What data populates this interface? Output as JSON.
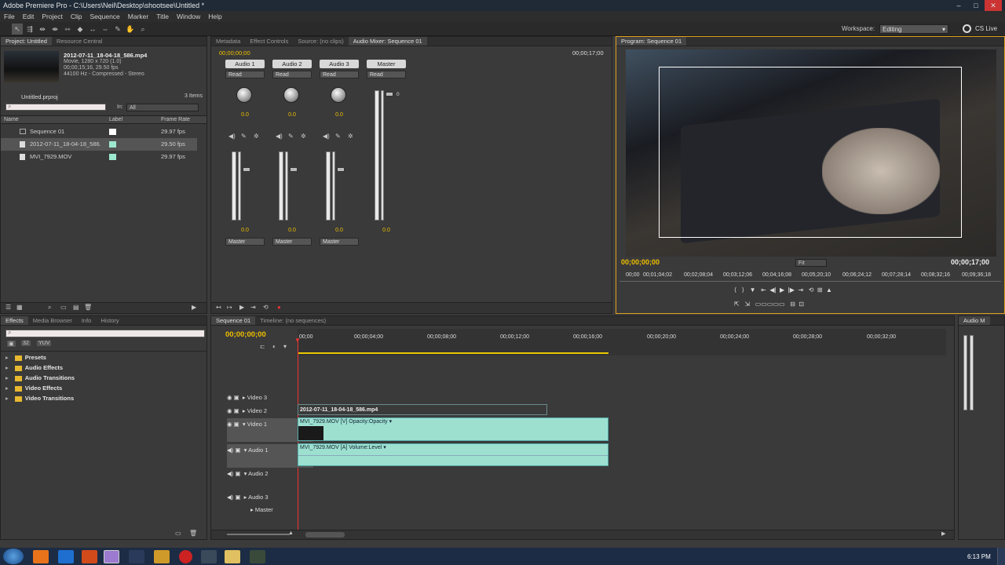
{
  "window": {
    "title": "Adobe Premiere Pro - C:\\Users\\Neil\\Desktop\\shootsee\\Untitled *"
  },
  "menu": [
    "File",
    "Edit",
    "Project",
    "Clip",
    "Sequence",
    "Marker",
    "Title",
    "Window",
    "Help"
  ],
  "workspace": {
    "label": "Workspace:",
    "value": "Editing",
    "cslive": "CS Live"
  },
  "project": {
    "tabs": [
      "Project: Untitled",
      "Resource Central"
    ],
    "clip_name": "2012-07-11_18-04-18_586.mp4",
    "clip_info": [
      "Movie, 1280 x 720 (1.0)",
      "00;00;15;16, 29.50 fps",
      "44100 Hz - Compressed - Stereo"
    ],
    "file": "Untitled.prproj",
    "items_count": "3 Items",
    "in_label": "In:",
    "in_value": "All",
    "columns": [
      "Name",
      "Label",
      "Frame Rate"
    ],
    "rows": [
      {
        "name": "Sequence 01",
        "label_color": "#ffffff",
        "fps": "29.97 fps"
      },
      {
        "name": "2012-07-11_18-04-18_586.",
        "label_color": "#9de8d0",
        "fps": "29.50 fps"
      },
      {
        "name": "MVI_7929.MOV",
        "label_color": "#9de8d0",
        "fps": "29.97 fps"
      }
    ]
  },
  "mixer": {
    "tabs": [
      "Metadata",
      "Effect Controls",
      "Source: (no clips)",
      "Audio Mixer: Sequence 01"
    ],
    "timecode_left": "00;00;00;00",
    "timecode_right": "00;00;17;00",
    "channels": [
      {
        "name": "Audio 1",
        "mode": "Read",
        "pan": "0.0",
        "level": "0.0",
        "out": "Master"
      },
      {
        "name": "Audio 2",
        "mode": "Read",
        "pan": "0.0",
        "level": "0.0",
        "out": "Master"
      },
      {
        "name": "Audio 3",
        "mode": "Read",
        "pan": "0.0",
        "level": "0.0",
        "out": "Master"
      }
    ],
    "master": {
      "name": "Master",
      "mode": "Read",
      "level": "0.0",
      "top_val": "0"
    }
  },
  "program": {
    "tab": "Program: Sequence 01",
    "timecode_left": "00;00;00;00",
    "timecode_right": "00;00;17;00",
    "fit": "Fit",
    "ruler": [
      "00;00",
      "00;01;04;02",
      "00;02;08;04",
      "00;03;12;06",
      "00;04;16;08",
      "00;05;20;10",
      "00;06;24;12",
      "00;07;28;14",
      "00;08;32;16",
      "00;09;36;18"
    ]
  },
  "effects": {
    "tabs": [
      "Effects",
      "Media Browser",
      "Info",
      "History"
    ],
    "folders": [
      "Presets",
      "Audio Effects",
      "Audio Transitions",
      "Video Effects",
      "Video Transitions"
    ]
  },
  "timeline": {
    "tabs": [
      "Sequence 01",
      "Timeline: (no sequences)"
    ],
    "timecode": "00;00;00;00",
    "ruler": [
      "00;00",
      "00;00;04;00",
      "00;00;08;00",
      "00;00;12;00",
      "00;00;16;00",
      "00;00;20;00",
      "00;00;24;00",
      "00;00;28;00",
      "00;00;32;00"
    ],
    "tracks": [
      "Video 3",
      "Video 2",
      "Video 1",
      "Audio 1",
      "Audio 2",
      "Audio 3",
      "Master"
    ],
    "clip_v2": "2012-07-11_18-04-18_586.mp4",
    "clip_v1": "MVI_7929.MOV [V]  Opacity:Opacity ▾",
    "clip_a1": "MVI_7929.MOV [A]  Volume:Level ▾"
  },
  "audio_meter_tab": "Audio M",
  "clock": "6:13 PM"
}
